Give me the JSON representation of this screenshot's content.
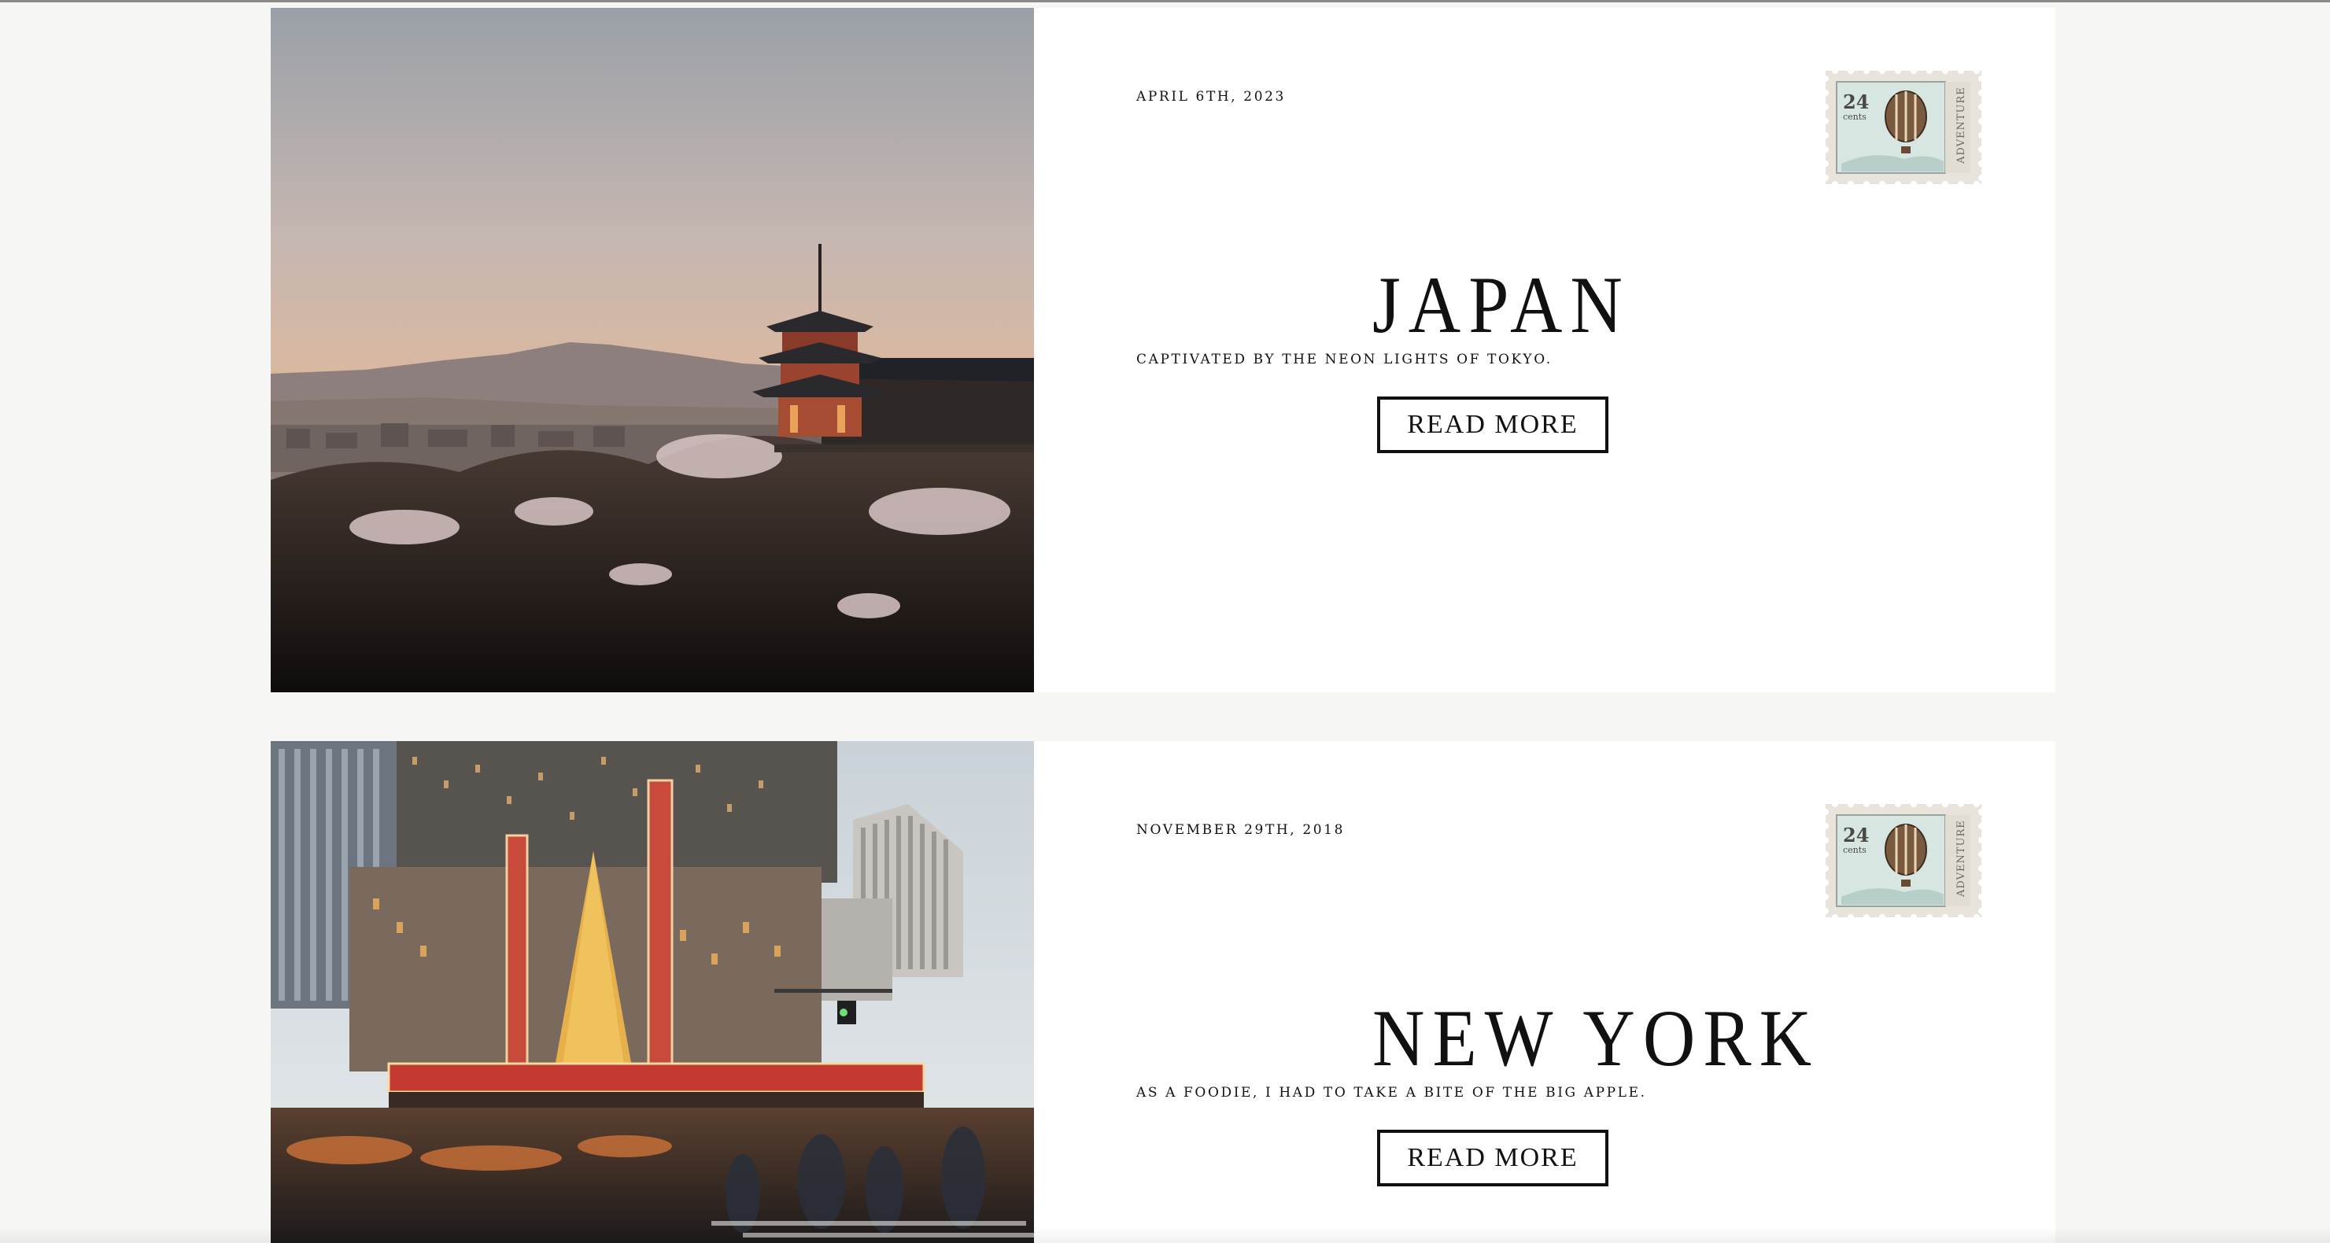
{
  "posts": [
    {
      "date": "April 6th, 2023",
      "title": "JAPAN",
      "excerpt": "Captivated by the neon lights of Tokyo.",
      "button_label": "READ MORE",
      "stamp": {
        "value": "24",
        "unit": "cents",
        "caption": "ADVENTURE"
      }
    },
    {
      "date": "November 29th, 2018",
      "title": "NEW YORK",
      "excerpt": "As a foodie, I had to take a bite of the big apple.",
      "button_label": "READ MORE",
      "stamp": {
        "value": "24",
        "unit": "cents",
        "caption": "ADVENTURE"
      }
    }
  ]
}
